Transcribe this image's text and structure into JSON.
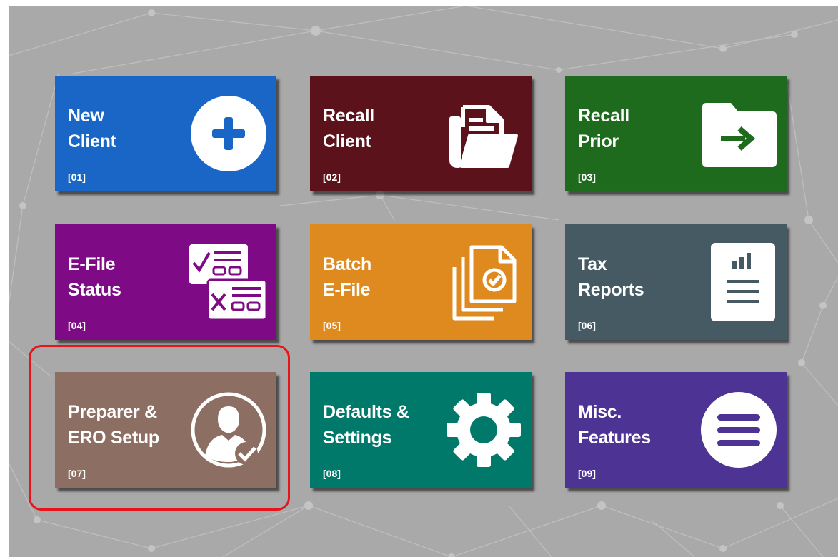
{
  "tiles": [
    {
      "title_line1": "New",
      "title_line2": "Client",
      "code": "[01]",
      "color": "#1a66c7",
      "icon": "plus-circle-icon"
    },
    {
      "title_line1": "Recall",
      "title_line2": "Client",
      "code": "[02]",
      "color": "#5b121a",
      "icon": "open-folder-icon"
    },
    {
      "title_line1": "Recall",
      "title_line2": "Prior",
      "code": "[03]",
      "color": "#1e6b1e",
      "icon": "folder-arrow-icon"
    },
    {
      "title_line1": "E-File",
      "title_line2": "Status",
      "code": "[04]",
      "color": "#7e0a85",
      "icon": "forms-check-cross-icon"
    },
    {
      "title_line1": "Batch",
      "title_line2": "E-File",
      "code": "[05]",
      "color": "#df8a1f",
      "icon": "stacked-documents-icon"
    },
    {
      "title_line1": "Tax",
      "title_line2": "Reports",
      "code": "[06]",
      "color": "#465a64",
      "icon": "report-chart-icon"
    },
    {
      "title_line1": "Preparer &",
      "title_line2": "ERO Setup",
      "code": "[07]",
      "color": "#8c6e63",
      "icon": "user-check-icon"
    },
    {
      "title_line1": "Defaults &",
      "title_line2": "Settings",
      "code": "[08]",
      "color": "#00796b",
      "icon": "gear-icon"
    },
    {
      "title_line1": "Misc.",
      "title_line2": "Features",
      "code": "[09]",
      "color": "#4d3393",
      "icon": "menu-circle-icon"
    }
  ],
  "colors": {
    "background": "#a9a9a9",
    "highlight": "#e8141c"
  }
}
